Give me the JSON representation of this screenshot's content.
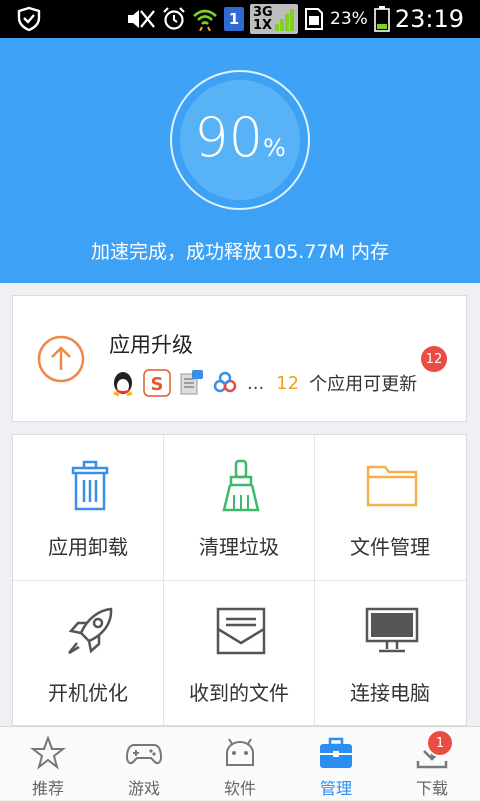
{
  "status_bar": {
    "battery": "23%",
    "time": "23:19",
    "sim": "1",
    "network": "3G 1X"
  },
  "hero": {
    "percent_value": "90",
    "percent_sign": "%",
    "message": "加速完成，成功释放105.77M 内存"
  },
  "upgrade": {
    "title": "应用升级",
    "ellipsis": "...",
    "count": "12",
    "suffix": "个应用可更新",
    "badge": "12"
  },
  "grid": {
    "items": [
      {
        "label": "应用卸载",
        "icon": "trash-icon"
      },
      {
        "label": "清理垃圾",
        "icon": "broom-icon"
      },
      {
        "label": "文件管理",
        "icon": "folder-icon"
      },
      {
        "label": "开机优化",
        "icon": "rocket-icon"
      },
      {
        "label": "收到的文件",
        "icon": "envelope-icon"
      },
      {
        "label": "连接电脑",
        "icon": "monitor-icon"
      }
    ]
  },
  "tabs": [
    {
      "label": "推荐",
      "icon": "star-icon"
    },
    {
      "label": "游戏",
      "icon": "gamepad-icon"
    },
    {
      "label": "软件",
      "icon": "android-icon"
    },
    {
      "label": "管理",
      "icon": "toolbox-icon",
      "active": true
    },
    {
      "label": "下载",
      "icon": "download-icon",
      "badge": "1"
    }
  ],
  "colors": {
    "accent": "#3da2f5",
    "orange": "#f0a020",
    "badge": "#ea4b43",
    "active_tab": "#2a8ef0"
  }
}
